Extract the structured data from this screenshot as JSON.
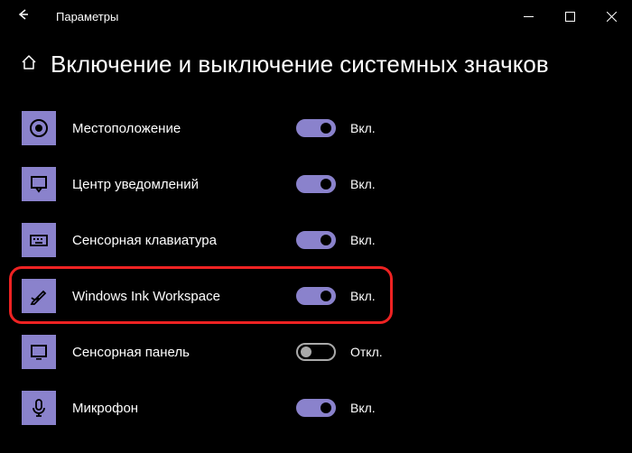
{
  "titlebar": {
    "title": "Параметры"
  },
  "page": {
    "title": "Включение и выключение системных значков"
  },
  "state_labels": {
    "on": "Вкл.",
    "off": "Откл."
  },
  "colors": {
    "accent": "#8a82cc"
  },
  "items": [
    {
      "icon": "location",
      "label": "Местоположение",
      "on": true
    },
    {
      "icon": "action-center",
      "label": "Центр уведомлений",
      "on": true
    },
    {
      "icon": "touch-keyboard",
      "label": "Сенсорная клавиатура",
      "on": true
    },
    {
      "icon": "ink-workspace",
      "label": "Windows Ink Workspace",
      "on": true
    },
    {
      "icon": "touchpad",
      "label": "Сенсорная панель",
      "on": false
    },
    {
      "icon": "microphone",
      "label": "Микрофон",
      "on": true
    }
  ],
  "highlight_index": 3
}
